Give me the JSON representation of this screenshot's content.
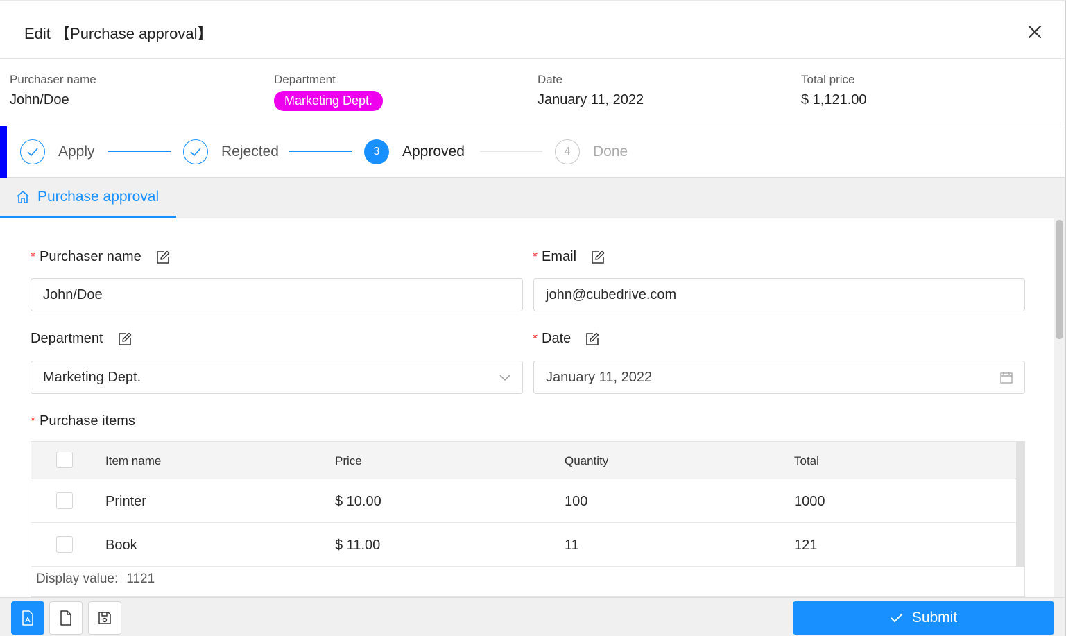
{
  "dialog": {
    "title": "Edit 【Purchase approval】"
  },
  "summary": {
    "purchaser_label": "Purchaser name",
    "purchaser_value": "John/Doe",
    "department_label": "Department",
    "department_value": "Marketing Dept.",
    "date_label": "Date",
    "date_value": "January 11, 2022",
    "total_label": "Total price",
    "total_value": "$ 1,121.00"
  },
  "steps": [
    {
      "label": "Apply",
      "status": "finished"
    },
    {
      "label": "Rejected",
      "status": "finished"
    },
    {
      "number": "3",
      "label": "Approved",
      "status": "current"
    },
    {
      "number": "4",
      "label": "Done",
      "status": "waiting"
    }
  ],
  "tab": {
    "label": "Purchase approval"
  },
  "form": {
    "purchaser_label": "Purchaser name",
    "purchaser_value": "John/Doe",
    "email_label": "Email",
    "email_value": "john@cubedrive.com",
    "department_label": "Department",
    "department_value": "Marketing Dept.",
    "date_label": "Date",
    "date_value": "January 11, 2022",
    "items_label": "Purchase items",
    "required_mark": "*"
  },
  "table": {
    "columns": [
      "Item name",
      "Price",
      "Quantity",
      "Total"
    ],
    "rows": [
      {
        "name": "Printer",
        "price": "$ 10.00",
        "quantity": "100",
        "total": "1000"
      },
      {
        "name": "Book",
        "price": "$ 11.00",
        "quantity": "11",
        "total": "121"
      }
    ],
    "display_label": "Display value:",
    "display_value": "1121"
  },
  "footer": {
    "submit_label": "Submit"
  },
  "colors": {
    "accent": "#1890ff",
    "department_tag": "#ee00ee",
    "required": "#ff3030",
    "steps_accent": "#0000ff"
  },
  "icons": [
    "close-icon",
    "check-icon",
    "home-icon",
    "edit-icon",
    "chevron-down-icon",
    "calendar-icon",
    "pdf-icon",
    "document-icon",
    "save-icon"
  ]
}
